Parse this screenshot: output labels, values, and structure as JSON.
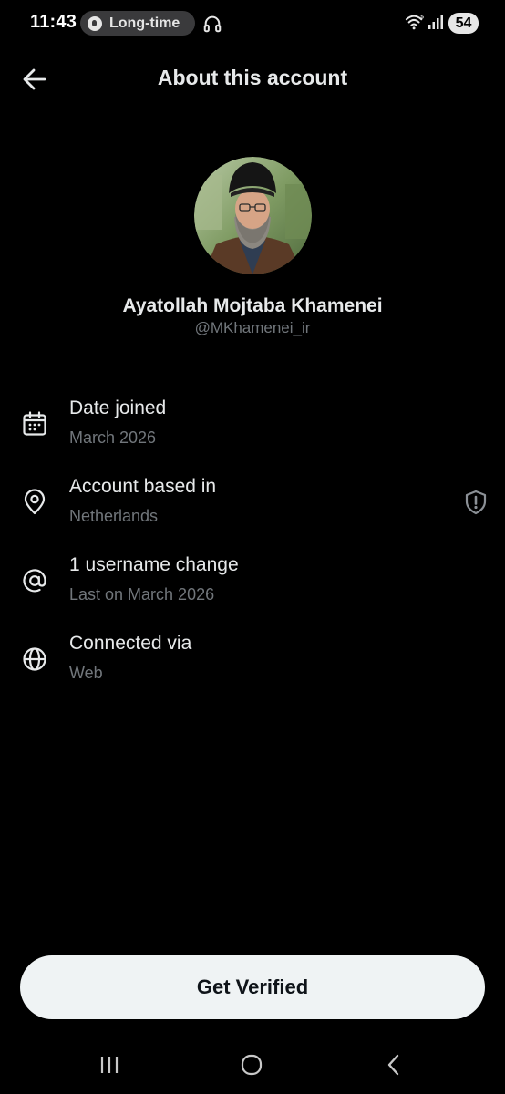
{
  "status_bar": {
    "time": "11:43",
    "pill_label": "Long-time",
    "battery": "54"
  },
  "header": {
    "title": "About this account"
  },
  "profile": {
    "display_name": "Ayatollah Mojtaba Khamenei",
    "handle": "@MKhamenei_ir"
  },
  "rows": [
    {
      "icon": "calendar-icon",
      "title": "Date joined",
      "subtitle": "March 2026"
    },
    {
      "icon": "location-pin-icon",
      "title": "Account based in",
      "subtitle": "Netherlands",
      "action_icon": "shield-alert-icon"
    },
    {
      "icon": "at-sign-icon",
      "title": "1 username change",
      "subtitle": "Last on March 2026"
    },
    {
      "icon": "globe-icon",
      "title": "Connected via",
      "subtitle": "Web"
    }
  ],
  "verify_button": {
    "label": "Get Verified"
  },
  "colors": {
    "background": "#000000",
    "primary_text": "#e7e9ea",
    "secondary_text": "#71767b",
    "button_bg": "#eff3f4"
  }
}
